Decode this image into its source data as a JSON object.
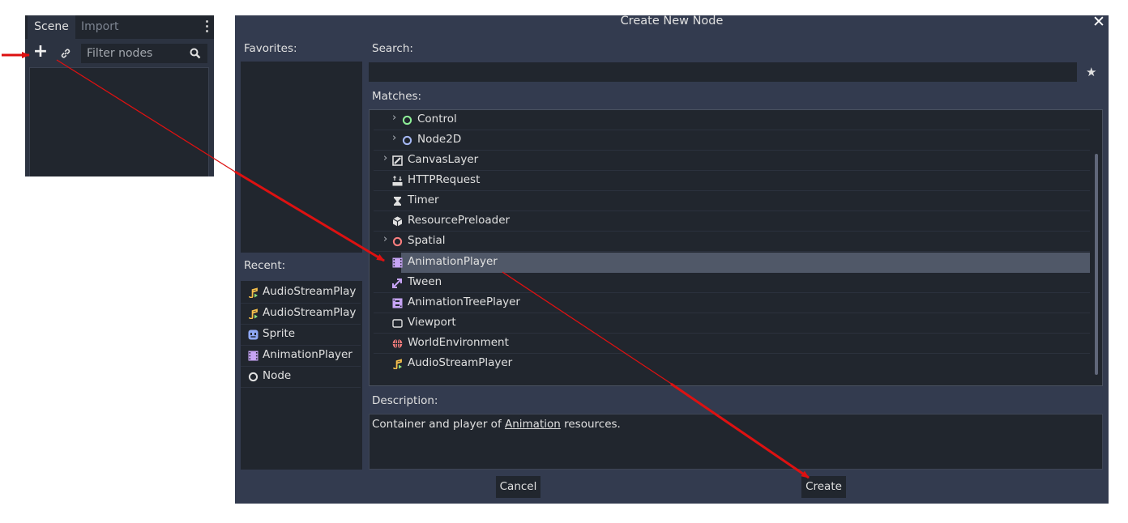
{
  "scene_dock": {
    "tabs": [
      "Scene",
      "Import"
    ],
    "active_tab": "Scene",
    "filter_placeholder": "Filter nodes",
    "icons": {
      "add": "plus-icon",
      "link": "link-icon",
      "search": "search-icon",
      "menu": "vertical-dots-icon"
    }
  },
  "dialog": {
    "title": "Create New Node",
    "close_icon": "close-icon",
    "favorites_label": "Favorites:",
    "recent_label": "Recent:",
    "recent": [
      {
        "label": "AudioStreamPlay",
        "icon": "audio-stream-icon"
      },
      {
        "label": "AudioStreamPlay",
        "icon": "audio-stream-icon"
      },
      {
        "label": "Sprite",
        "icon": "sprite-icon"
      },
      {
        "label": "AnimationPlayer",
        "icon": "animation-player-icon"
      },
      {
        "label": "Node",
        "icon": "node-icon"
      }
    ],
    "search_label": "Search:",
    "search_value": "",
    "favorite_icon": "star-icon",
    "matches_label": "Matches:",
    "matches": [
      {
        "label": "Control",
        "icon": "control-icon",
        "expandable": true,
        "indent": 2
      },
      {
        "label": "Node2D",
        "icon": "node2d-icon",
        "expandable": true,
        "indent": 2
      },
      {
        "label": "CanvasLayer",
        "icon": "canvas-layer-icon",
        "expandable": true,
        "indent": 1
      },
      {
        "label": "HTTPRequest",
        "icon": "http-request-icon",
        "expandable": false,
        "indent": 1
      },
      {
        "label": "Timer",
        "icon": "timer-icon",
        "expandable": false,
        "indent": 1
      },
      {
        "label": "ResourcePreloader",
        "icon": "resource-preloader-icon",
        "expandable": false,
        "indent": 1
      },
      {
        "label": "Spatial",
        "icon": "spatial-icon",
        "expandable": true,
        "indent": 1
      },
      {
        "label": "AnimationPlayer",
        "icon": "animation-player-icon",
        "expandable": false,
        "indent": 1,
        "selected": true
      },
      {
        "label": "Tween",
        "icon": "tween-icon",
        "expandable": false,
        "indent": 1
      },
      {
        "label": "AnimationTreePlayer",
        "icon": "animation-tree-player-icon",
        "expandable": false,
        "indent": 1
      },
      {
        "label": "Viewport",
        "icon": "viewport-icon",
        "expandable": false,
        "indent": 1
      },
      {
        "label": "WorldEnvironment",
        "icon": "world-environment-icon",
        "expandable": false,
        "indent": 1
      },
      {
        "label": "AudioStreamPlayer",
        "icon": "audio-stream-icon",
        "expandable": false,
        "indent": 1
      }
    ],
    "description_label": "Description:",
    "description": {
      "before": "Container and player of ",
      "link": "Animation",
      "after": " resources."
    },
    "cancel_label": "Cancel",
    "create_label": "Create"
  },
  "colors": {
    "background": "#333b4f",
    "panel": "#21262e",
    "selection": "#505868",
    "annotation_arrow": "#dd1111"
  }
}
